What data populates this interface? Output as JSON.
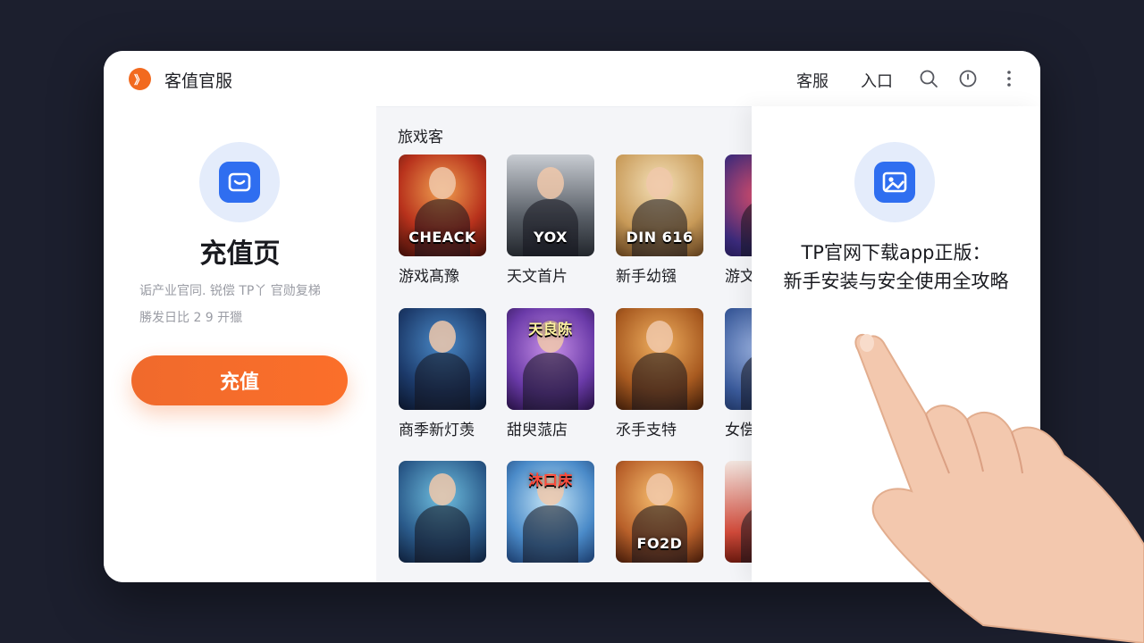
{
  "app": {
    "title": "客值官服",
    "logo_glyph": "》"
  },
  "topbar": {
    "customer_service": "客服",
    "entry": "入口"
  },
  "icons": {
    "search": "search-icon",
    "clock": "clock-icon",
    "more": "more-vertical-icon"
  },
  "recharge_panel": {
    "title": "充值页",
    "desc_line1": "诟产业官同. 锐偿 TP丫 官勋复梯",
    "desc_line2": "勝发日比 2 9   开獵",
    "button": "充值"
  },
  "games_section": {
    "title": "旅戏客",
    "rows": [
      [
        {
          "name": "游戏髙豫",
          "art_text": "CHEACK"
        },
        {
          "name": "天文首片",
          "art_text": "YOX"
        },
        {
          "name": "新手幼镪",
          "art_text": "DIN 616"
        },
        {
          "name": "游文",
          "art_text": ""
        }
      ],
      [
        {
          "name": "商季新灯羡",
          "art_text": ""
        },
        {
          "name": "甜臾蒎店",
          "art_text": "天良陈"
        },
        {
          "name": "氶手支特",
          "art_text": ""
        },
        {
          "name": "女偿",
          "art_text": ""
        }
      ],
      [
        {
          "name": "",
          "art_text": ""
        },
        {
          "name": "",
          "art_text": "沐口床"
        },
        {
          "name": "",
          "art_text": "FO2D"
        },
        {
          "name": "",
          "art_text": ""
        }
      ]
    ]
  },
  "article_panel": {
    "title_line1": "TP官网下载app正版：",
    "title_line2": "新手安装与安全使用全攻略"
  },
  "colors": {
    "accent_orange": "#f26a1f",
    "accent_blue": "#2f6ef0",
    "background": "#1c1f2e"
  }
}
